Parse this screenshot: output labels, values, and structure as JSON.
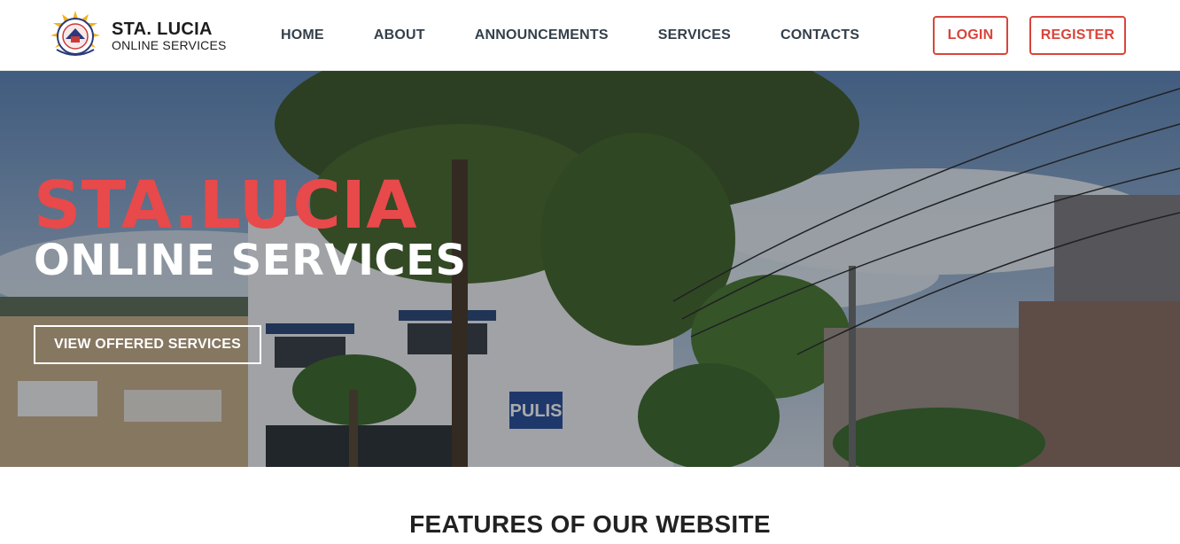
{
  "brand": {
    "title": "STA. LUCIA",
    "subtitle": "ONLINE SERVICES",
    "logo_icon": "barangay-seal-icon"
  },
  "nav": {
    "items": [
      {
        "label": "HOME"
      },
      {
        "label": "ABOUT"
      },
      {
        "label": "ANNOUNCEMENTS"
      },
      {
        "label": "SERVICES"
      },
      {
        "label": "CONTACTS"
      }
    ]
  },
  "auth": {
    "login_label": "LOGIN",
    "register_label": "REGISTER"
  },
  "hero": {
    "title": "STA.LUCIA",
    "subtitle": "ONLINE SERVICES",
    "cta_label": "VIEW OFFERED SERVICES",
    "sign_text": "PULIS"
  },
  "features": {
    "heading": "FEATURES OF OUR WEBSITE"
  },
  "colors": {
    "accent": "#e8494a",
    "button_border": "#d9443a",
    "nav_text": "#34404b",
    "header_bg": "#ffffff"
  }
}
